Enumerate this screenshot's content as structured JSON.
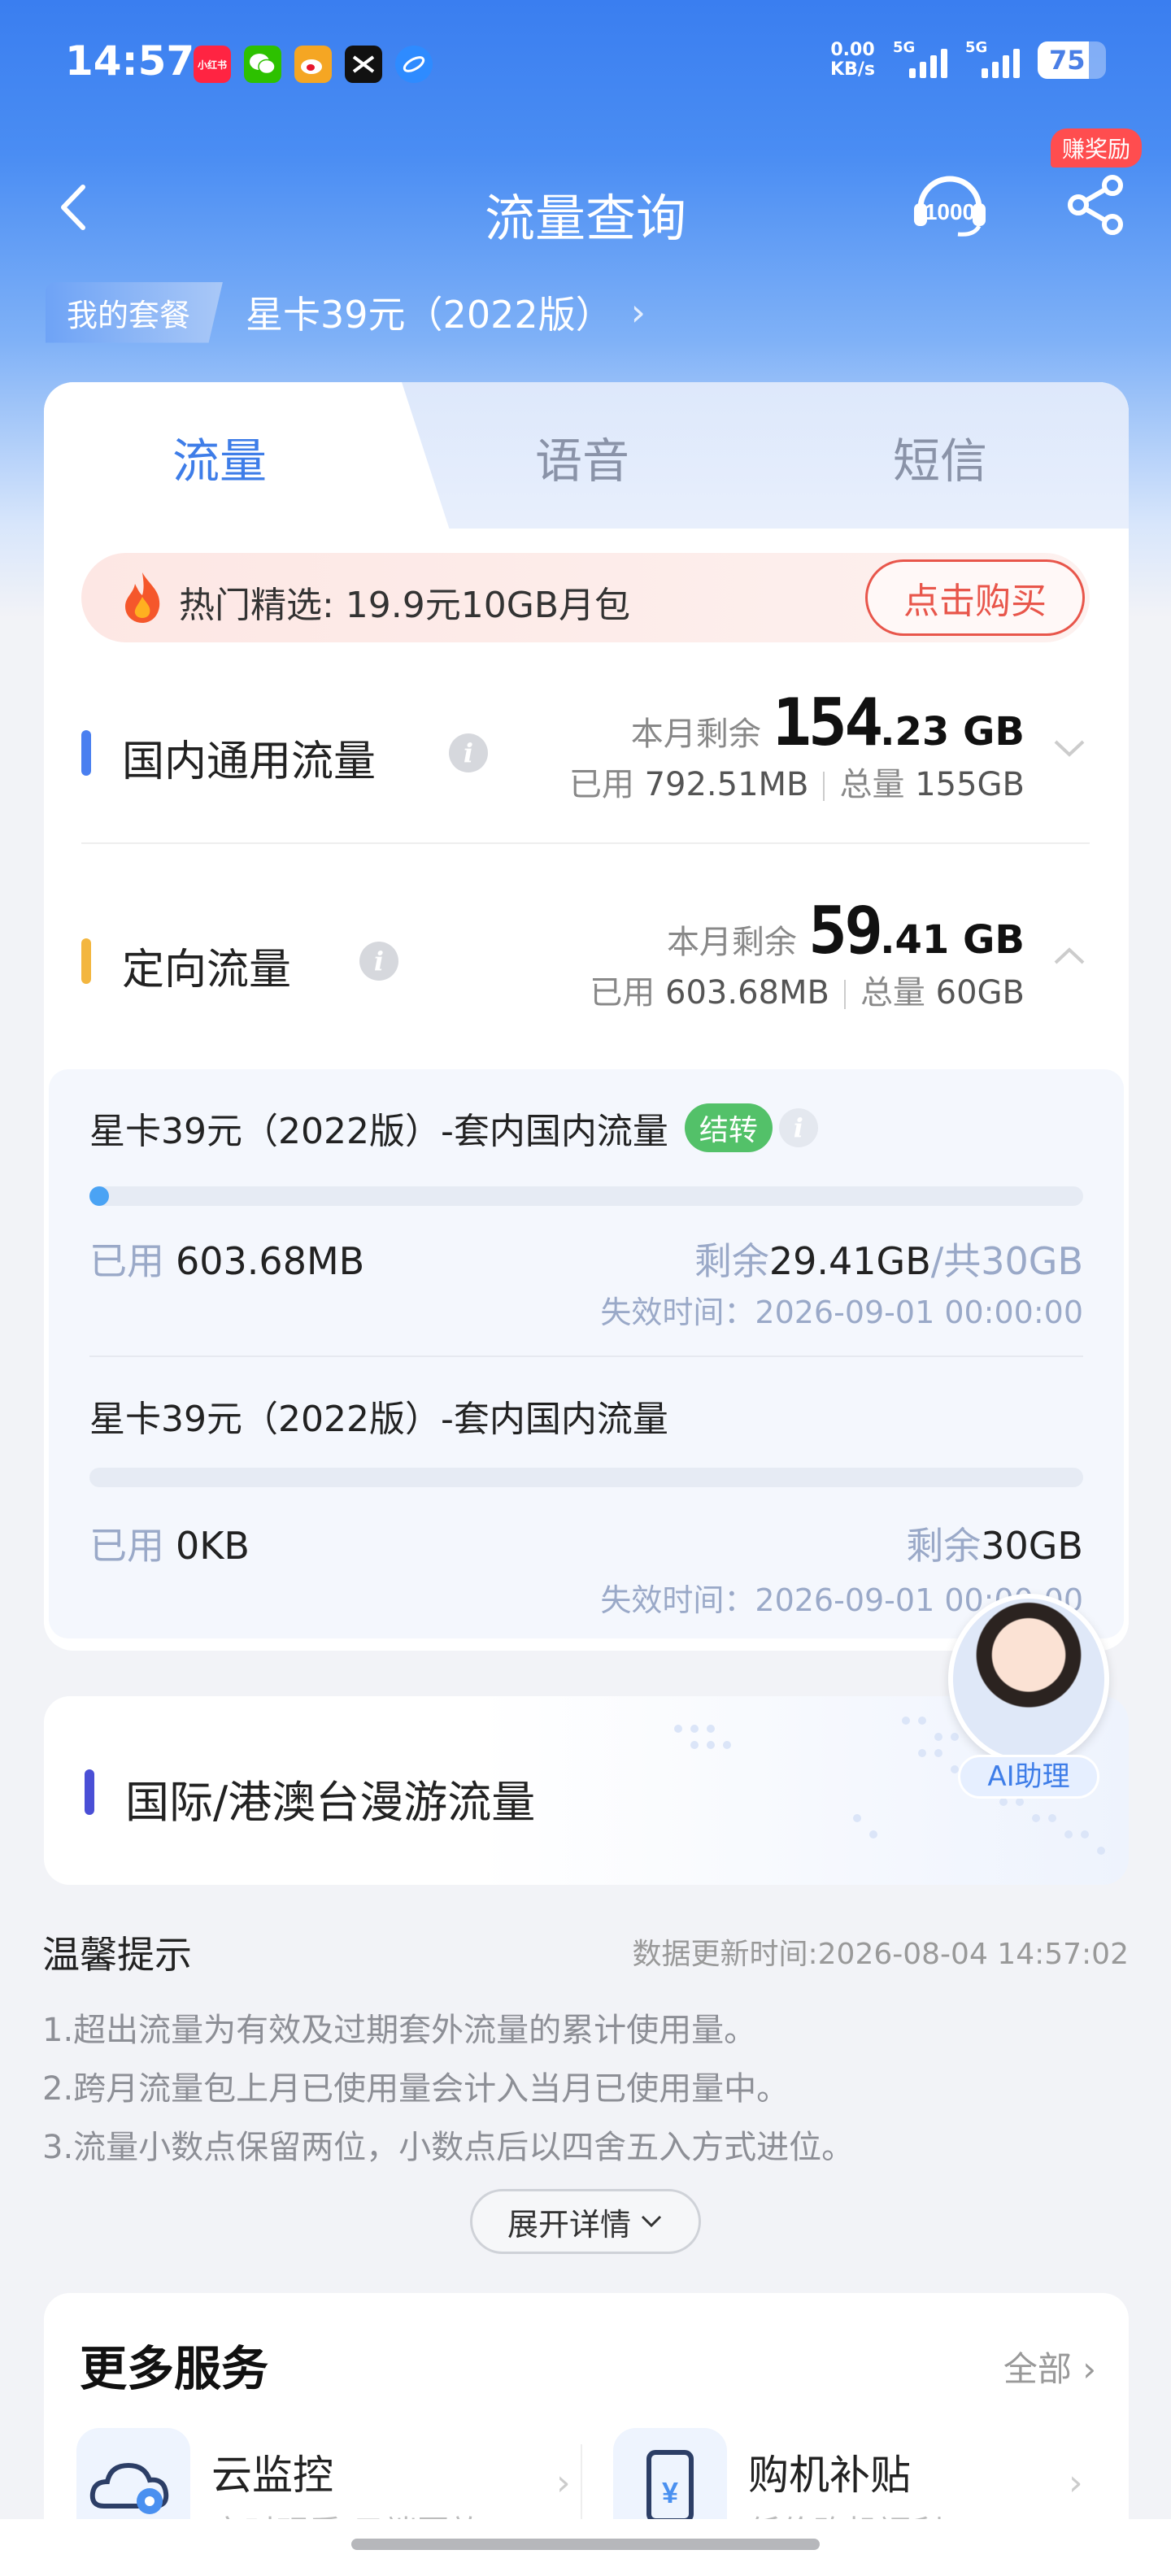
{
  "status_bar": {
    "time": "14:57",
    "apps": [
      {
        "icon": "xiaohongshu-icon",
        "color": "#ff2442",
        "text": "小红书"
      },
      {
        "icon": "wechat-icon",
        "color": "#2dc100",
        "text": ""
      },
      {
        "icon": "weibo-icon",
        "color": "#f5a623",
        "text": ""
      },
      {
        "icon": "capcut-icon",
        "color": "#111111",
        "text": ""
      },
      {
        "icon": "browser-icon",
        "color": "#2e8bff",
        "text": ""
      }
    ],
    "net_speed": "0.00",
    "net_unit": "KB/s",
    "sig1_label": "5G",
    "sig2_label": "5G",
    "battery": "75"
  },
  "header": {
    "title": "流量查询",
    "reward_badge": "赚奖励"
  },
  "plan": {
    "tag": "我的套餐",
    "name": "星卡39元（2022版）"
  },
  "tabs": [
    {
      "label": "流量",
      "active": true
    },
    {
      "label": "语音",
      "active": false
    },
    {
      "label": "短信",
      "active": false
    }
  ],
  "promo": {
    "text": "热门精选: 19.9元10GB月包",
    "button": "点击购买"
  },
  "domestic": {
    "name": "国内通用流量",
    "remain_label": "本月剩余",
    "remain_int": "154",
    "remain_dec": ".23 GB",
    "used_label": "已用",
    "used": "792.51MB",
    "total_label": "总量",
    "total": "155GB",
    "color": "#4a7ff0"
  },
  "directed": {
    "name": "定向流量",
    "remain_label": "本月剩余",
    "remain_int": "59",
    "remain_dec": ".41 GB",
    "used_label": "已用",
    "used": "603.68MB",
    "total_label": "总量",
    "total": "60GB",
    "color": "#f3b63f"
  },
  "sub_items": [
    {
      "title": "星卡39元（2022版）-套内国内流量",
      "badge": "结转",
      "progress": 0.02,
      "used_label": "已用",
      "used": "603.68MB",
      "left_label": "剩余",
      "left": "29.41GB",
      "total": "/共30GB",
      "expire": "失效时间：2026-09-01 00:00:00"
    },
    {
      "title": "星卡39元（2022版）-套内国内流量",
      "badge": "",
      "progress": 0,
      "used_label": "已用",
      "used": "0KB",
      "left_label": "剩余",
      "left": "30GB",
      "total": "",
      "expire": "失效时间：2026-09-01 00:00:00"
    }
  ],
  "roaming": {
    "title": "国际/港澳台漫游流量"
  },
  "ai": {
    "label": "AI助理"
  },
  "tips": {
    "title": "温馨提示",
    "update_time": "数据更新时间:2026-08-04 14:57:02",
    "items": [
      "1.超出流量为有效及过期套外流量的累计使用量。",
      "2.跨月流量包上月已使用量会计入当月已使用量中。",
      "3.流量小数点保留两位，小数点后以四舍五入方式进位。"
    ],
    "expand": "展开详情"
  },
  "services": {
    "title": "更多服务",
    "all": "全部",
    "items": [
      {
        "name": "云监控",
        "desc": "实时观看 云端回放",
        "icon": "cloud-camera-icon"
      },
      {
        "name": "购机补贴",
        "desc": "低价购机福利",
        "icon": "phone-subsidy-icon"
      }
    ]
  }
}
